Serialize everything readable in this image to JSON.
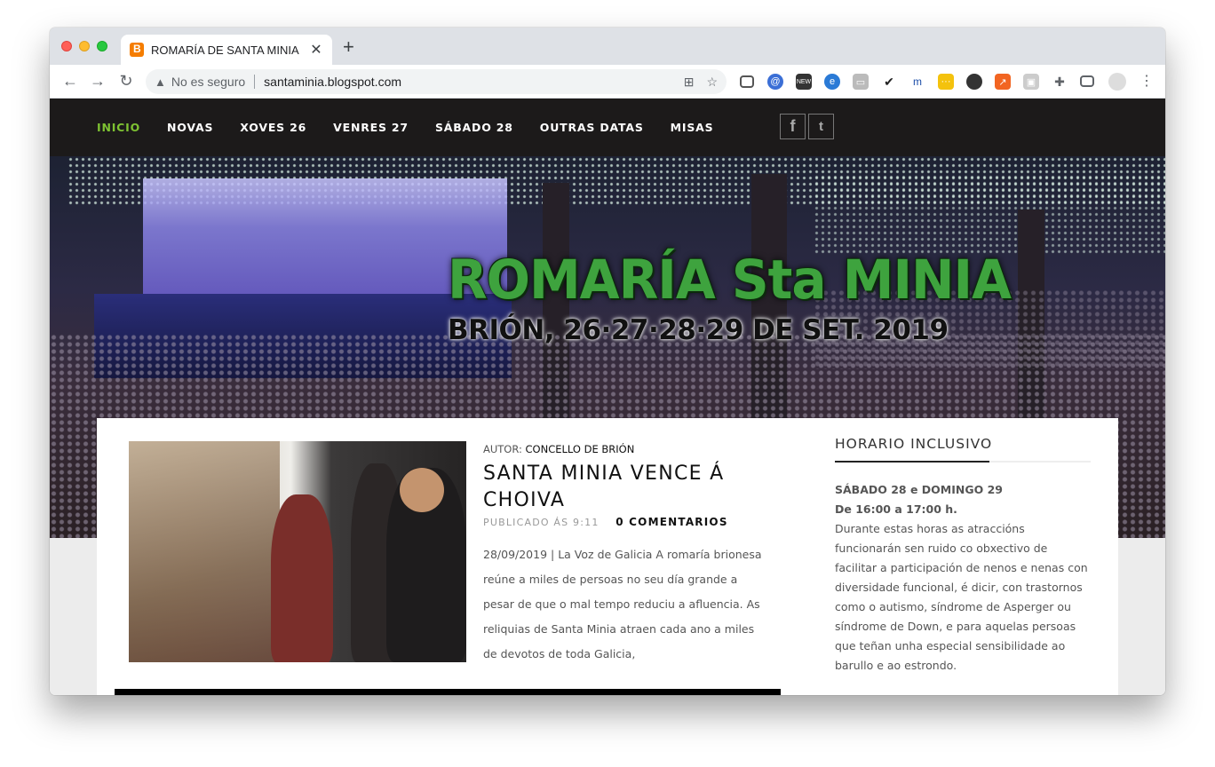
{
  "browser": {
    "tab_title": "ROMARÍA DE SANTA MINIA",
    "tab_close": "✕",
    "new_tab": "+",
    "security_label": "No es seguro",
    "url": "santaminia.blogspot.com"
  },
  "nav": {
    "items": [
      {
        "label": "INICIO",
        "active": true
      },
      {
        "label": "NOVAS"
      },
      {
        "label": "XOVES 26"
      },
      {
        "label": "VENRES 27"
      },
      {
        "label": "SÁBADO 28"
      },
      {
        "label": "OUTRAS DATAS"
      },
      {
        "label": "MISAS"
      }
    ],
    "accent_color": "#7ec232",
    "background_color": "#1c1a1a"
  },
  "hero": {
    "title": "ROMARÍA Sta MINIA",
    "subtitle": "BRIÓN, 26·27·28·29 DE SET. 2019"
  },
  "post": {
    "author_prefix": "AUTOR:",
    "author_name": "CONCELLO DE BRIÓN",
    "title": "SANTA MINIA VENCE Á CHOIVA",
    "published": "PUBLICADO ÁS 9:11",
    "comments": "0 COMENTARIOS",
    "excerpt": "28/09/2019 | La Voz de Galicia A romaría brionesa reúne a miles de persoas no seu día grande a pesar de que o mal tempo reduciu a afluencia. As reliquias de Santa Minia atraen cada ano a miles de devotos de toda Galicia,"
  },
  "sidebar": {
    "title": "HORARIO INCLUSIVO",
    "heading1": "SÁBADO 28 e DOMINGO 29",
    "heading2": "De 16:00 a 17:00 h.",
    "body": "Durante estas horas as atraccións funcionarán sen ruido co obxectivo de facilitar a participación de nenos e nenas con diversidade funcional, é dicir, con trastornos como o autismo, síndrome de Asperger ou síndrome de Down, e para aquelas persoas que teñan unha especial sensibilidade ao barullo e ao estrondo."
  }
}
